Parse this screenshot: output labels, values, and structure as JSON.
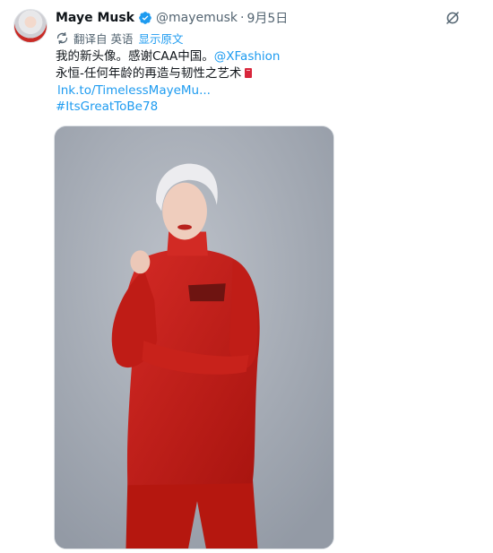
{
  "tweet": {
    "author": {
      "name": "Maye Musk",
      "handle": "@mayemusk",
      "date": "9月5日",
      "verified_color": "#1d9bf0"
    },
    "translation": {
      "label": "翻译自 英语",
      "show_original": "显示原文"
    },
    "text": {
      "line1_text": "我的新头像。感谢CAA中国。",
      "line1_mention": "@XFashion",
      "line2_text": "永恒-任何年龄的再造与韧性之艺术",
      "line3_link": "lnk.to/TimelessMayeMu...",
      "line4_hashtag": "#ItsGreatToBe78"
    },
    "icons": {
      "avatar": "avatar-photo",
      "verified": "verified-badge-icon",
      "grok": "grok-slash-icon",
      "translate": "translate-icon",
      "emoji": "red-book-emoji"
    },
    "media": {
      "description_colors": {
        "background": "#a9afb8",
        "outfit": "#c8201d"
      }
    },
    "colors": {
      "link": "#1d9bf0",
      "secondary_text": "#536471",
      "primary_text": "#0f1419"
    }
  }
}
